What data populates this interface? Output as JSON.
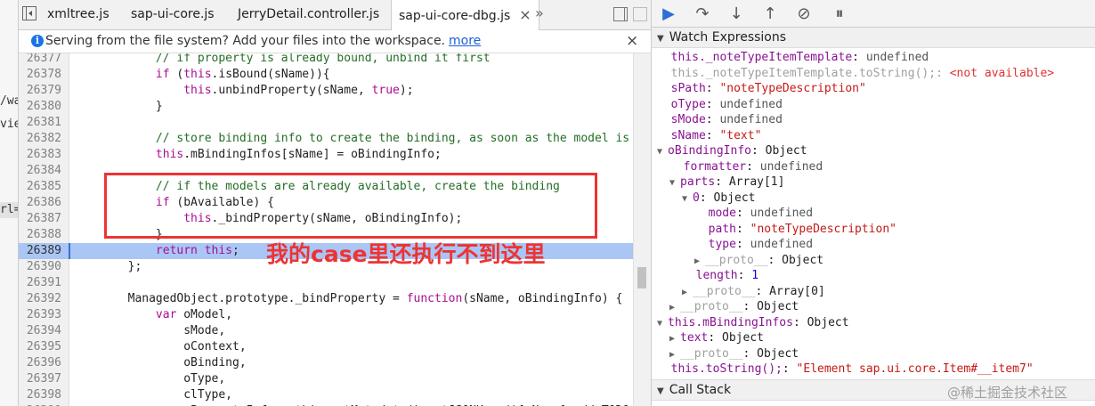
{
  "left_strip": {
    "stubs": [
      "/wa",
      "vie",
      "rl=\""
    ]
  },
  "tabs": [
    {
      "label": "xmltree.js",
      "active": false
    },
    {
      "label": "sap-ui-core.js",
      "active": false
    },
    {
      "label": "JerryDetail.controller.js",
      "active": false
    },
    {
      "label": "sap-ui-core-dbg.js",
      "active": true
    }
  ],
  "tab_overflow": "»",
  "infobar": {
    "message": "Serving from the file system? Add your files into the workspace.",
    "link": "more",
    "close": "×"
  },
  "code_lines": [
    {
      "num": "26377",
      "parts": [
        [
          "c",
          "            // if property is already bound, unbind it first"
        ]
      ]
    },
    {
      "num": "26378",
      "parts": [
        [
          "k",
          "            if"
        ],
        [
          "",
          " ("
        ],
        [
          "k",
          "this"
        ],
        [
          "",
          ".isBound(sName)){"
        ]
      ]
    },
    {
      "num": "26379",
      "parts": [
        [
          "k",
          "                this"
        ],
        [
          "",
          ".unbindProperty(sName, "
        ],
        [
          "k",
          "true"
        ],
        [
          "",
          ");"
        ]
      ]
    },
    {
      "num": "26380",
      "parts": [
        [
          "",
          "            }"
        ]
      ]
    },
    {
      "num": "26381",
      "parts": [
        [
          "",
          ""
        ]
      ]
    },
    {
      "num": "26382",
      "parts": [
        [
          "c",
          "            // store binding info to create the binding, as soon as the model is"
        ]
      ]
    },
    {
      "num": "26383",
      "parts": [
        [
          "k",
          "            this"
        ],
        [
          "",
          ".mBindingInfos[sName] = oBindingInfo;"
        ]
      ]
    },
    {
      "num": "26384",
      "parts": [
        [
          "",
          ""
        ]
      ]
    },
    {
      "num": "26385",
      "parts": [
        [
          "c",
          "            // if the models are already available, create the binding"
        ]
      ]
    },
    {
      "num": "26386",
      "parts": [
        [
          "k",
          "            if"
        ],
        [
          "",
          " (bAvailable) {"
        ]
      ]
    },
    {
      "num": "26387",
      "parts": [
        [
          "k",
          "                this"
        ],
        [
          "",
          "._bindProperty(sName, oBindingInfo);"
        ]
      ]
    },
    {
      "num": "26388",
      "parts": [
        [
          "",
          "            }"
        ]
      ]
    },
    {
      "num": "26389",
      "parts": [
        [
          "k",
          "            return this"
        ],
        [
          "",
          ";"
        ]
      ],
      "exec": true
    },
    {
      "num": "26390",
      "parts": [
        [
          "",
          "        };"
        ]
      ]
    },
    {
      "num": "26391",
      "parts": [
        [
          "",
          ""
        ]
      ]
    },
    {
      "num": "26392",
      "parts": [
        [
          "",
          "        ManagedObject.prototype._bindProperty = "
        ],
        [
          "k",
          "function"
        ],
        [
          "",
          "(sName, oBindingInfo) {"
        ]
      ]
    },
    {
      "num": "26393",
      "parts": [
        [
          "k",
          "            var"
        ],
        [
          "",
          " oModel,"
        ]
      ]
    },
    {
      "num": "26394",
      "parts": [
        [
          "",
          "                sMode,"
        ]
      ]
    },
    {
      "num": "26395",
      "parts": [
        [
          "",
          "                oContext,"
        ]
      ]
    },
    {
      "num": "26396",
      "parts": [
        [
          "",
          "                oBinding,"
        ]
      ]
    },
    {
      "num": "26397",
      "parts": [
        [
          "",
          "                oType,"
        ]
      ]
    },
    {
      "num": "26398",
      "parts": [
        [
          "",
          "                clType,"
        ]
      ]
    },
    {
      "num": "26399",
      "parts": [
        [
          "",
          "                oPropertyInfo = this.getMetadata().getJSONKeys()[sName]; // TODO"
        ]
      ]
    }
  ],
  "annotation": "我的case里还执行不到这里",
  "debugger": {
    "watch_title": "Watch Expressions",
    "callstack_title": "Call Stack",
    "watch_lines": [
      {
        "indent": 0,
        "tri": "",
        "parts": [
          [
            "wk",
            "this._noteTypeItemTemplate"
          ],
          [
            "",
            ": "
          ],
          [
            "wv",
            "undefined"
          ]
        ]
      },
      {
        "indent": 0,
        "tri": "",
        "parts": [
          [
            "wgray",
            "this._noteTypeItemTemplate.toString();"
          ],
          [
            "wgray",
            ": "
          ],
          [
            "wred",
            "<not available>"
          ]
        ]
      },
      {
        "indent": 0,
        "tri": "",
        "parts": [
          [
            "wk",
            "sPath"
          ],
          [
            "",
            ": "
          ],
          [
            "ws",
            "\"noteTypeDescription\""
          ]
        ]
      },
      {
        "indent": 0,
        "tri": "",
        "parts": [
          [
            "wk",
            "oType"
          ],
          [
            "",
            ": "
          ],
          [
            "wv",
            "undefined"
          ]
        ]
      },
      {
        "indent": 0,
        "tri": "",
        "parts": [
          [
            "wk",
            "sMode"
          ],
          [
            "",
            ": "
          ],
          [
            "wv",
            "undefined"
          ]
        ]
      },
      {
        "indent": 0,
        "tri": "",
        "parts": [
          [
            "wk",
            "sName"
          ],
          [
            "",
            ": "
          ],
          [
            "ws",
            "\"text\""
          ]
        ]
      },
      {
        "indent": 0,
        "tri": "▼",
        "parts": [
          [
            "wk",
            "oBindingInfo"
          ],
          [
            "",
            ": Object"
          ]
        ]
      },
      {
        "indent": 1,
        "tri": "",
        "parts": [
          [
            "wk",
            "formatter"
          ],
          [
            "",
            ": "
          ],
          [
            "wv",
            "undefined"
          ]
        ]
      },
      {
        "indent": 1,
        "tri": "▼",
        "parts": [
          [
            "wk",
            "parts"
          ],
          [
            "",
            ": Array[1]"
          ]
        ]
      },
      {
        "indent": 2,
        "tri": "▼",
        "parts": [
          [
            "wk",
            "0"
          ],
          [
            "",
            ": Object"
          ]
        ]
      },
      {
        "indent": 3,
        "tri": "",
        "parts": [
          [
            "wk",
            "mode"
          ],
          [
            "",
            ": "
          ],
          [
            "wv",
            "undefined"
          ]
        ]
      },
      {
        "indent": 3,
        "tri": "",
        "parts": [
          [
            "wk",
            "path"
          ],
          [
            "",
            ": "
          ],
          [
            "ws",
            "\"noteTypeDescription\""
          ]
        ]
      },
      {
        "indent": 3,
        "tri": "",
        "parts": [
          [
            "wk",
            "type"
          ],
          [
            "",
            ": "
          ],
          [
            "wv",
            "undefined"
          ]
        ]
      },
      {
        "indent": 3,
        "tri": "▶",
        "parts": [
          [
            "wgray",
            "__proto__"
          ],
          [
            "",
            ": Object"
          ]
        ]
      },
      {
        "indent": 2,
        "tri": "",
        "parts": [
          [
            "wk",
            "length"
          ],
          [
            "",
            ": "
          ],
          [
            "wn",
            "1"
          ]
        ]
      },
      {
        "indent": 2,
        "tri": "▶",
        "parts": [
          [
            "wgray",
            "__proto__"
          ],
          [
            "",
            ": Array[0]"
          ]
        ]
      },
      {
        "indent": 1,
        "tri": "▶",
        "parts": [
          [
            "wgray",
            "__proto__"
          ],
          [
            "",
            ": Object"
          ]
        ]
      },
      {
        "indent": 0,
        "tri": "▼",
        "parts": [
          [
            "wk",
            "this.mBindingInfos"
          ],
          [
            "",
            ": Object"
          ]
        ]
      },
      {
        "indent": 1,
        "tri": "▶",
        "parts": [
          [
            "wk",
            "text"
          ],
          [
            "",
            ": Object"
          ]
        ]
      },
      {
        "indent": 1,
        "tri": "▶",
        "parts": [
          [
            "wgray",
            "__proto__"
          ],
          [
            "",
            ": Object"
          ]
        ]
      },
      {
        "indent": 0,
        "tri": "",
        "parts": [
          [
            "wk",
            "this.toString();"
          ],
          [
            "",
            ": "
          ],
          [
            "ws",
            "\"Element sap.ui.core.Item#__item7\""
          ]
        ]
      }
    ]
  },
  "watermark": "@稀土掘金技术社区"
}
